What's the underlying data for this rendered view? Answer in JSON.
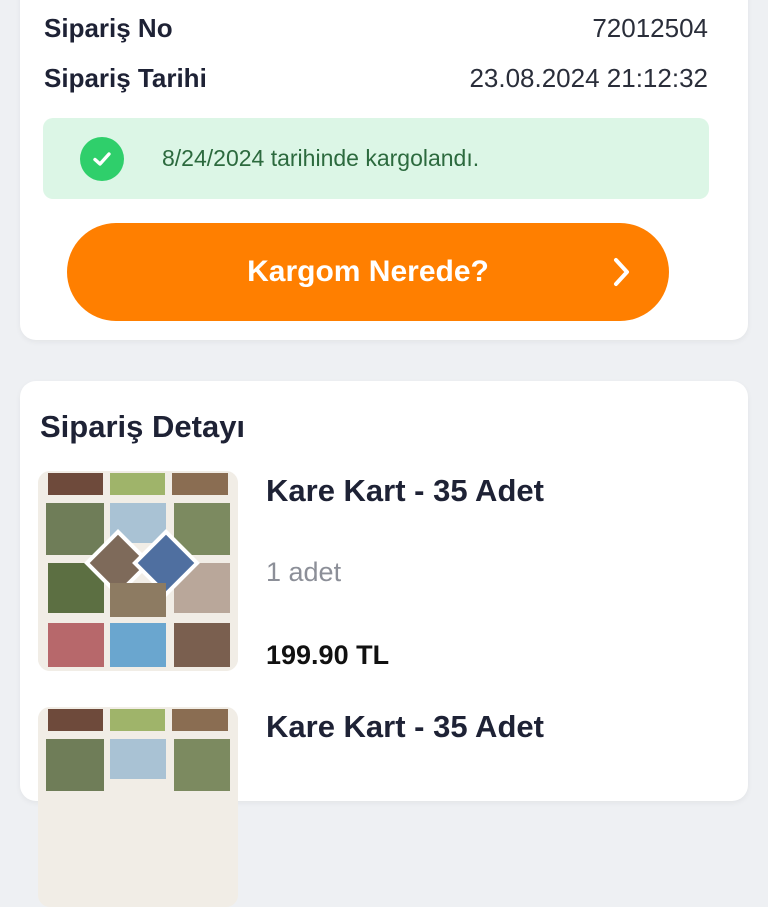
{
  "order": {
    "number_label": "Sipariş No",
    "number_value": "72012504",
    "date_label": "Sipariş Tarihi",
    "date_value": "23.08.2024 21:12:32"
  },
  "status": {
    "text": "8/24/2024 tarihinde kargolandı.",
    "icon": "check-circle-icon",
    "color": "#2fcf6b",
    "background": "#dcf6e6"
  },
  "track_button": {
    "label": "Kargom Nerede?",
    "icon": "chevron-right-icon",
    "color": "#ff7f00"
  },
  "detail": {
    "title": "Sipariş Detayı",
    "items": [
      {
        "title": "Kare Kart - 35 Adet",
        "qty": "1 adet",
        "price": "199.90 TL"
      },
      {
        "title": "Kare Kart - 35 Adet"
      }
    ]
  }
}
